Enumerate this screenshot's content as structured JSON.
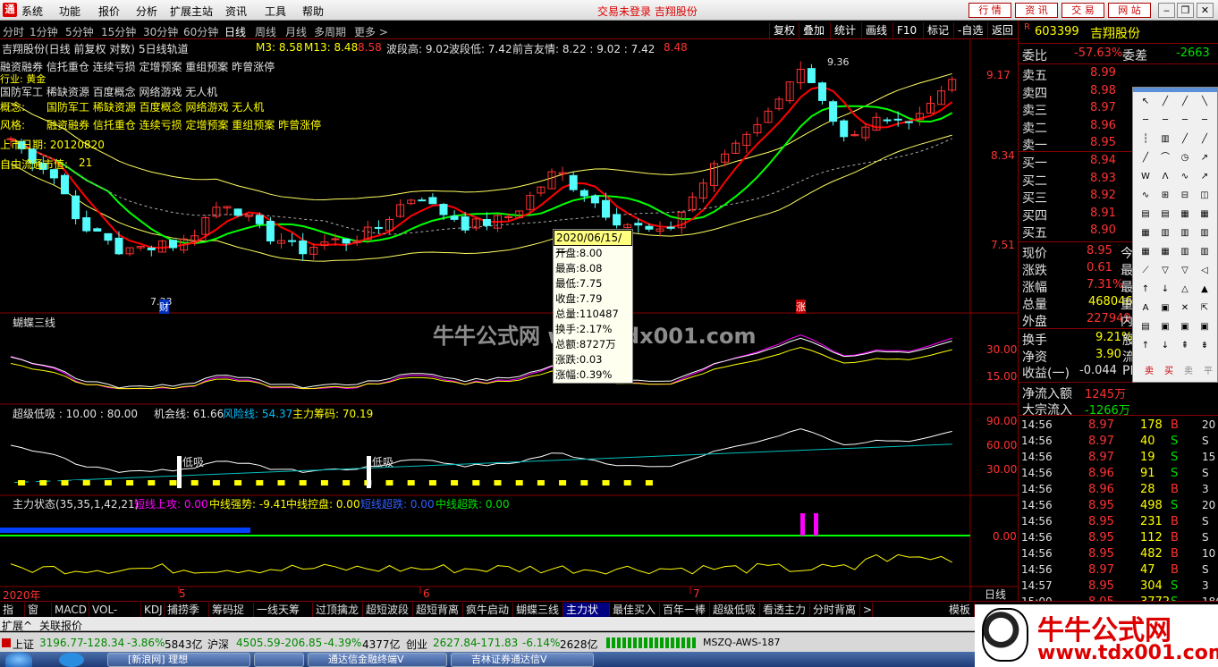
{
  "menu": {
    "items": [
      "系统",
      "功能",
      "报价",
      "分析",
      "扩展主站",
      "资讯",
      "工具",
      "帮助"
    ],
    "status": "交易未登录 吉翔股份",
    "buttons": [
      "行 情",
      "资 讯",
      "交 易",
      "网 站"
    ]
  },
  "periods": [
    "分时",
    "1分钟",
    "5分钟",
    "15分钟",
    "30分钟",
    "60分钟",
    "日线",
    "周线",
    "月线",
    "多周期",
    "更多 >"
  ],
  "right_tools": [
    "复权",
    "叠加",
    "统计",
    "画线",
    "F10",
    "标记",
    "-自选",
    "返回"
  ],
  "main": {
    "title": "吉翔股份(日线 前复权 对数)",
    "ma_name": "5日线轨道",
    "m3": "M3: 8.58",
    "m13": "M13: 8.48",
    "ma_val": "8.58",
    "bo_high": "波段高: 9.02",
    "bo_low": "波段低: 7.42",
    "qianyan": "前言友情: 8.22 : 9.02 : 7.42",
    "last": "8.48",
    "y_ticks": [
      "9.17",
      "8.34",
      "7.51"
    ],
    "low_label": "7.33",
    "high_label": "9.36",
    "cai": "财",
    "zhang": "涨"
  },
  "info": {
    "line1": "融资融券 信托重仓 连续亏损 定增预案 重组预案 昨曾涨停",
    "line1b": "行业: 黄金",
    "line2": "国防军工 稀缺资源 百度概念 网络游戏 无人机",
    "concept_label": "概念:",
    "concept": "国防军工 稀缺资源 百度概念 网络游戏 无人机",
    "style_label": "风格:",
    "style": "融资融券 信托重仓 连续亏损 定增预案 重组预案 昨曾涨停",
    "list_date": "上市日期: 20120820",
    "float_cap_label": "自由流通市值:",
    "float_cap": "21"
  },
  "tooltip": {
    "date": "2020/06/15/一",
    "rows": [
      "开盘:8.00",
      "最高:8.08",
      "最低:7.75",
      "收盘:7.79",
      "总量:110487",
      "换手:2.17%",
      "总额:8727万",
      "涨跌:0.03",
      "涨幅:0.39%"
    ]
  },
  "watermark_center": "牛牛公式网 www.tdx001.com",
  "butterfly": {
    "title": "蝴蝶三线",
    "ticks": [
      "30.00",
      "15.00"
    ]
  },
  "superlow": {
    "title": "超级低吸 : 10.00 : 80.00",
    "chance": "机会线: 61.66",
    "risk": "风险线: 54.37",
    "main": "主力筹码: 70.19",
    "ticks": [
      "90.00",
      "60.00",
      "30.00"
    ],
    "labels": [
      "低吸",
      "低吸"
    ]
  },
  "mainstate": {
    "title": "主力状态(35,35,1,42,21)",
    "s1": "短线上攻: 0.00",
    "s2": "中线强势: -9.41",
    "s3": "中线控盘: 0.00",
    "s4": "短线超跌: 0.00",
    "s5": "中线超跌: 0.00",
    "tick": "0.00"
  },
  "xaxis": {
    "labels": [
      "2020年",
      "5",
      "6",
      "7"
    ],
    "right": "日线"
  },
  "tabs": [
    "指标",
    "窗口",
    "MACD",
    "VOL-TDX",
    "KDJ",
    "捕捞季节",
    "筹码捉牛",
    "一线天筹码",
    "过顶擒龙",
    "超短波段",
    "超短背离",
    "疯牛启动",
    "蝴蝶三线",
    "主力状态",
    "最佳买入",
    "百年一棒",
    "超级低吸",
    "看透主力",
    "分时背离",
    ">",
    "模板"
  ],
  "tabs2": [
    "扩展^",
    "关联报价"
  ],
  "status": {
    "sh_label": "上证",
    "sh": "3196.77",
    "sh_chg": "-128.34",
    "sh_pct": "-3.86%",
    "sh_amt": "5843亿",
    "sz_label": "沪深",
    "sz": "4505.59",
    "sz_chg": "-206.85",
    "sz_pct": "-4.39%",
    "sz_amt": "4377亿",
    "cy_label": "创业",
    "cy": "2627.84",
    "cy_chg": "-171.83",
    "cy_pct": "-6.14%",
    "cy_amt": "2628亿",
    "server": "MSZQ-AWS-187"
  },
  "taskbar": [
    "[新浪网] 理想",
    "",
    "通达信金融终端V",
    "吉林证券通达信V"
  ],
  "quote": {
    "code": "603399",
    "name": "吉翔股份",
    "r_label": "R",
    "weibi_label": "委比",
    "weibi": "-57.63%",
    "weicha_label": "委差",
    "weicha": "-2663",
    "sells": [
      {
        "label": "卖五",
        "price": "8.99"
      },
      {
        "label": "卖四",
        "price": "8.98"
      },
      {
        "label": "卖三",
        "price": "8.97"
      },
      {
        "label": "卖二",
        "price": "8.96"
      },
      {
        "label": "卖一",
        "price": "8.95"
      }
    ],
    "buys": [
      {
        "label": "买一",
        "price": "8.94"
      },
      {
        "label": "买二",
        "price": "8.93"
      },
      {
        "label": "买三",
        "price": "8.92"
      },
      {
        "label": "买四",
        "price": "8.91"
      },
      {
        "label": "买五",
        "price": "8.90"
      }
    ],
    "stats": [
      {
        "label": "现价",
        "value": "8.95",
        "tail": "今"
      },
      {
        "label": "涨跌",
        "value": "0.61",
        "tail": "最"
      },
      {
        "label": "涨幅",
        "value": "7.31%",
        "tail": "最"
      },
      {
        "label": "总量",
        "value": "468046",
        "tail": "量"
      },
      {
        "label": "外盘",
        "value": "227949",
        "tail": "内"
      }
    ],
    "stats2": [
      {
        "label": "换手",
        "value": "9.21%",
        "tail": "股"
      },
      {
        "label": "净资",
        "value": "3.90",
        "tail": "流"
      },
      {
        "label": "收益(一)",
        "value": "-0.044",
        "tail": "PE"
      }
    ],
    "flow": [
      {
        "label": "净流入额",
        "value": "1245万"
      },
      {
        "label": "大宗流入",
        "value": "-1266万"
      }
    ],
    "ticks": [
      {
        "t": "14:56",
        "p": "8.97",
        "v": "178",
        "d": "B"
      },
      {
        "t": "14:56",
        "p": "8.97",
        "v": "40",
        "d": "S"
      },
      {
        "t": "14:56",
        "p": "8.97",
        "v": "19",
        "d": "S"
      },
      {
        "t": "14:56",
        "p": "8.96",
        "v": "91",
        "d": "S"
      },
      {
        "t": "14:56",
        "p": "8.96",
        "v": "28",
        "d": "B"
      },
      {
        "t": "14:56",
        "p": "8.95",
        "v": "498",
        "d": "S"
      },
      {
        "t": "14:56",
        "p": "8.95",
        "v": "231",
        "d": "B"
      },
      {
        "t": "14:56",
        "p": "8.95",
        "v": "112",
        "d": "B"
      },
      {
        "t": "14:56",
        "p": "8.95",
        "v": "482",
        "d": "B"
      },
      {
        "t": "14:56",
        "p": "8.97",
        "v": "47",
        "d": "B"
      },
      {
        "t": "14:57",
        "p": "8.95",
        "v": "304",
        "d": "S"
      },
      {
        "t": "15:00",
        "p": "8.95",
        "v": "3772",
        "d": "S"
      }
    ],
    "tick_tail": [
      "20",
      "S",
      "15",
      "S",
      "3",
      "20",
      "S",
      "S",
      "10",
      "S",
      "3",
      "186"
    ]
  },
  "toolbox": [
    "卖",
    "买",
    "卖",
    "平"
  ],
  "brand": {
    "title": "牛牛公式网",
    "url": "www.tdx001.com"
  },
  "colors": {
    "up": "#ff3232",
    "down": "#54fcfc",
    "ma5": "#ff0000",
    "ma10": "#00ff00",
    "ma_yellow": "#ffff60"
  }
}
